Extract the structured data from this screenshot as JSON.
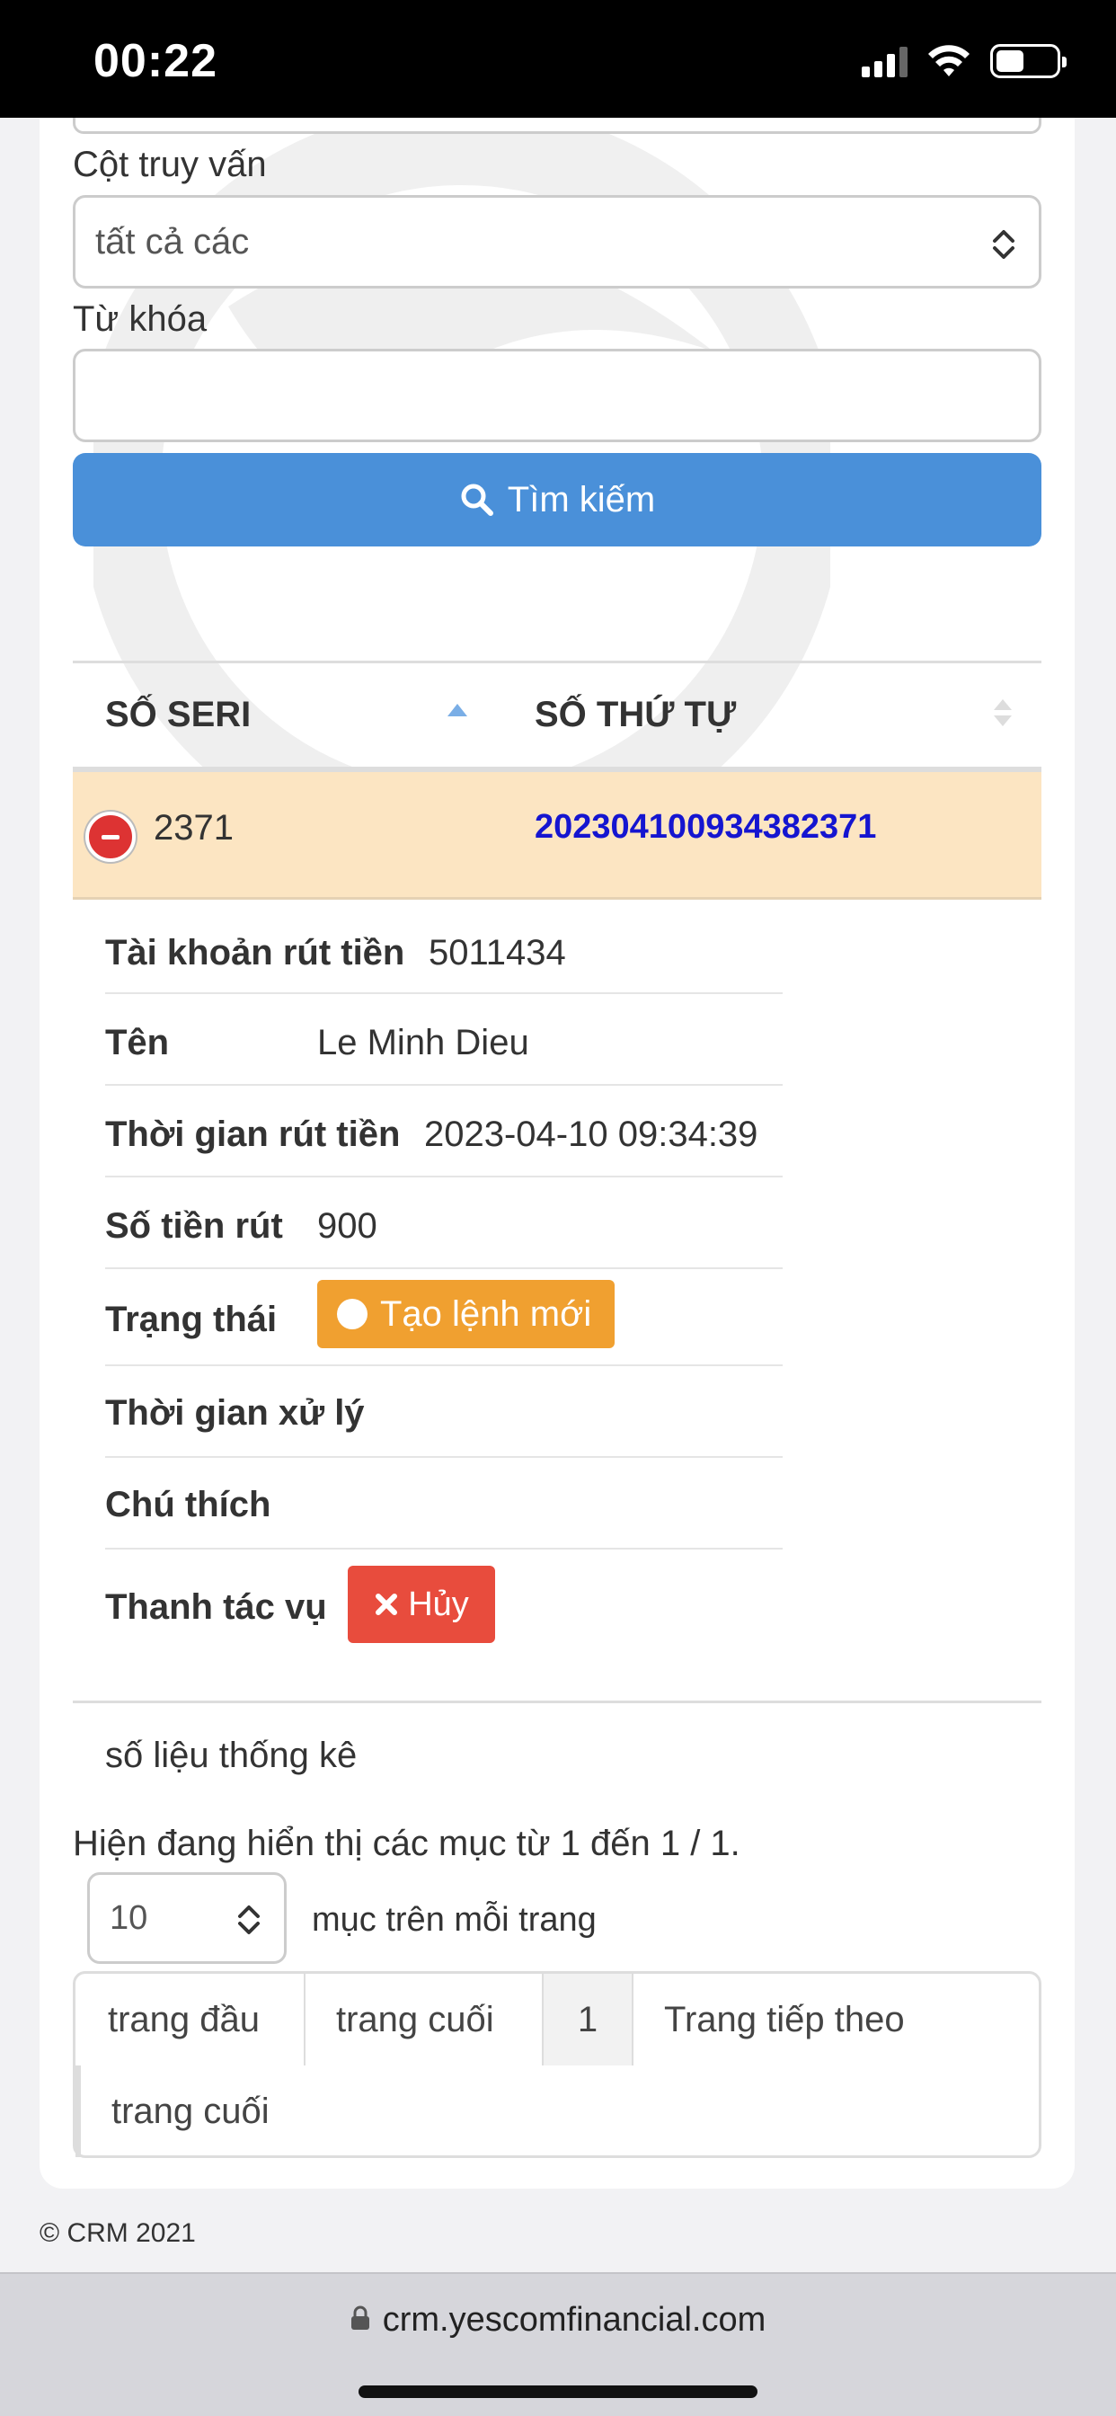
{
  "status_bar": {
    "time": "00:22"
  },
  "form": {
    "query_column_label": "Cột truy vấn",
    "query_column_value": "tất cả các",
    "keyword_label": "Từ khóa",
    "keyword_value": "",
    "search_label": "Tìm kiếm"
  },
  "table": {
    "headers": [
      "SỐ SERI",
      "SỐ THỨ TỰ"
    ],
    "row": {
      "seri": "2371",
      "order": "20230410093438237­1"
    }
  },
  "detail": {
    "account_label": "Tài khoản rút tiền",
    "account_value": "5011434",
    "name_label": "Tên",
    "name_value": "Le Minh Dieu",
    "time_label": "Thời gian rút tiền",
    "time_value": "2023-04-10 09:34:39",
    "amount_label": "Số tiền rút",
    "amount_value": "900",
    "status_label": "Trạng thái",
    "status_value": "Tạo lệnh mới",
    "processed_label": "Thời gian xử lý",
    "processed_value": "",
    "note_label": "Chú thích",
    "note_value": "",
    "actions_label": "Thanh tác vụ",
    "cancel_label": "Hủy"
  },
  "stats_label": "số liệu thống kê",
  "pagination": {
    "info": "Hiện đang hiển thị các mục từ 1 đến 1 / 1.",
    "per_page_value": "10",
    "per_page_label": "mục trên mỗi trang",
    "first": "trang đầu",
    "prev": "trang cuối",
    "current": "1",
    "next": "Trang tiếp theo",
    "last": "trang cuối"
  },
  "footer": "© CRM 2021",
  "url": "crm.yescomfinancial.com",
  "colors": {
    "primary": "#4a90d9",
    "row_highlight": "#fce5c2",
    "status_orange": "#f0a030",
    "cancel_red": "#e84c3d",
    "link_blue": "#1515d0"
  }
}
